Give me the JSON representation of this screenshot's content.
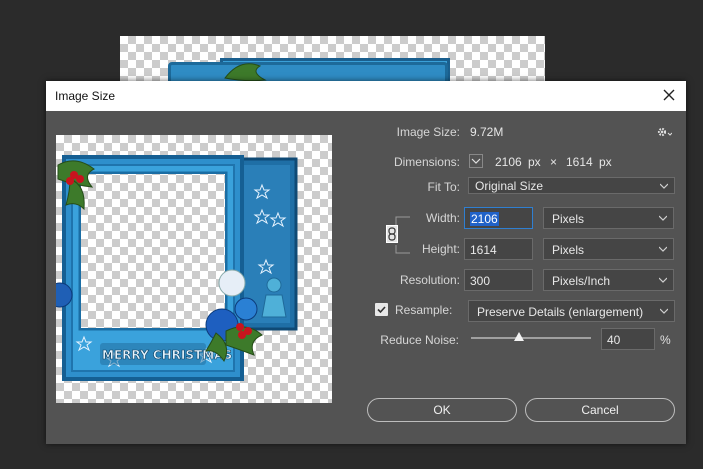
{
  "dialog": {
    "title": "Image Size",
    "image_size_label": "Image Size:",
    "image_size_value": "9.72M",
    "dimensions_label": "Dimensions:",
    "dimensions_width": "2106",
    "dimensions_width_unit": "px",
    "dimensions_times": "×",
    "dimensions_height": "1614",
    "dimensions_height_unit": "px",
    "fit_to_label": "Fit To:",
    "fit_to_value": "Original Size",
    "width_label": "Width:",
    "width_value": "2106",
    "width_unit": "Pixels",
    "height_label": "Height:",
    "height_value": "1614",
    "height_unit": "Pixels",
    "resolution_label": "Resolution:",
    "resolution_value": "300",
    "resolution_unit": "Pixels/Inch",
    "resample_label": "Resample:",
    "resample_checked": true,
    "resample_value": "Preserve Details (enlargement)",
    "reduce_noise_label": "Reduce Noise:",
    "reduce_noise_value": "40",
    "reduce_noise_percent": 40,
    "reduce_noise_unit": "%",
    "ok_label": "OK",
    "cancel_label": "Cancel"
  },
  "preview": {
    "banner_text": "MERRY CHRISTMAS"
  },
  "colors": {
    "dialog_bg": "#535353",
    "frame_blue": "#2f8cc4",
    "accent_blue": "#2162c8"
  }
}
